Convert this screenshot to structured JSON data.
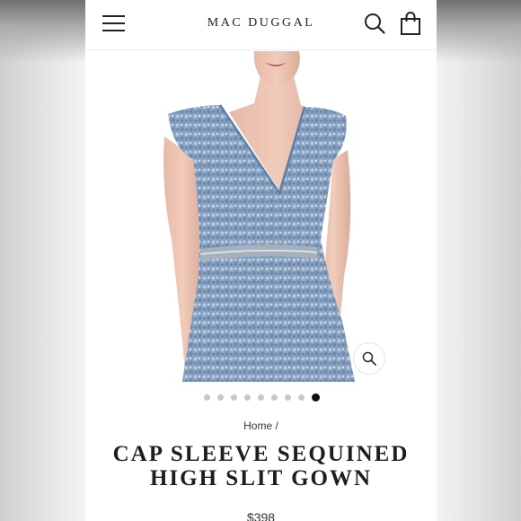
{
  "header": {
    "brand": "MAC DUGGAL",
    "icons": {
      "menu": "hamburger-menu-icon",
      "search": "search-icon",
      "cart": "shopping-bag-icon"
    }
  },
  "gallery": {
    "image_alt": "Model wearing blue cap sleeve sequined gown",
    "slide_count": 9,
    "active_slide": 9,
    "zoom_icon": "magnifier-zoom-icon"
  },
  "breadcrumb": {
    "home": "Home",
    "separator": "/"
  },
  "product": {
    "title_line1": "CAP SLEEVE SEQUINED",
    "title_line2": "HIGH SLIT GOWN",
    "price": "$398"
  },
  "colors": {
    "dress": "#8fa9c6",
    "accent": "#111111",
    "text": "#1e1e1e"
  }
}
